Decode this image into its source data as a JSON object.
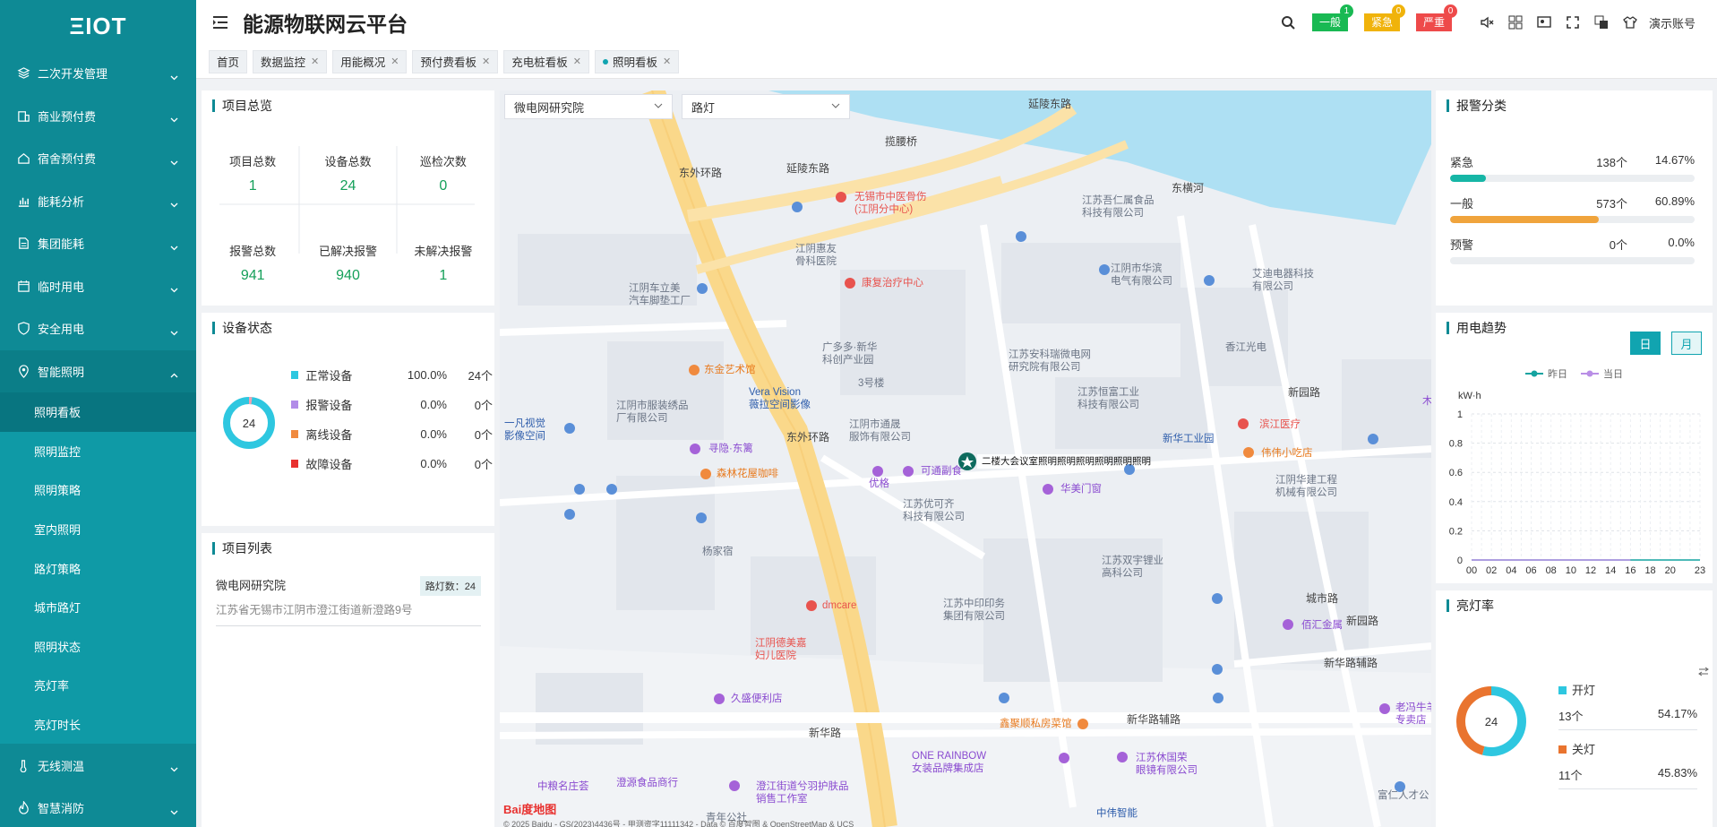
{
  "app": {
    "logo": "ΞIOT",
    "title": "能源物联网云平台",
    "user": "演示账号"
  },
  "colors": {
    "sidebar": "#0e8a95",
    "accent": "#0e8a95",
    "value_green": "#15a05a",
    "normal": "#11a4b0",
    "alarm_general": "#19b953",
    "alarm_urgent": "#f0b30b",
    "alarm_severe": "#ee4a4a"
  },
  "sidebar": {
    "menus": [
      {
        "label": "二次开发管理",
        "icon": "layers-icon"
      },
      {
        "label": "商业预付费",
        "icon": "building-icon"
      },
      {
        "label": "宿舍预付费",
        "icon": "home-icon"
      },
      {
        "label": "能耗分析",
        "icon": "bar-chart-icon"
      },
      {
        "label": "集团能耗",
        "icon": "document-icon"
      },
      {
        "label": "临时用电",
        "icon": "calendar-icon"
      },
      {
        "label": "安全用电",
        "icon": "shield-icon"
      },
      {
        "label": "智能照明",
        "icon": "location-icon"
      }
    ],
    "submenu": [
      "照明看板",
      "照明监控",
      "照明策略",
      "室内照明",
      "路灯策略",
      "城市路灯",
      "照明状态",
      "亮灯率",
      "亮灯时长"
    ],
    "bottom": [
      {
        "label": "无线测温",
        "icon": "thermometer-icon"
      },
      {
        "label": "智慧消防",
        "icon": "fire-icon"
      }
    ]
  },
  "header": {
    "alarms": [
      {
        "label": "一般",
        "count": "1"
      },
      {
        "label": "紧急",
        "count": "0"
      },
      {
        "label": "严重",
        "count": "0"
      }
    ]
  },
  "tabs": [
    {
      "label": "首页",
      "closable": false
    },
    {
      "label": "数据监控",
      "closable": true
    },
    {
      "label": "用能概况",
      "closable": true
    },
    {
      "label": "预付费看板",
      "closable": true
    },
    {
      "label": "充电桩看板",
      "closable": true
    },
    {
      "label": "照明看板",
      "closable": true,
      "active": true
    }
  ],
  "overview": {
    "title": "项目总览",
    "cells": [
      {
        "label": "项目总数",
        "value": "1"
      },
      {
        "label": "设备总数",
        "value": "24"
      },
      {
        "label": "巡检次数",
        "value": "0"
      },
      {
        "label": "报警总数",
        "value": "941"
      },
      {
        "label": "已解决报警",
        "value": "940"
      },
      {
        "label": "未解决报警",
        "value": "1"
      }
    ]
  },
  "device_status": {
    "title": "设备状态",
    "total": "24",
    "rows": [
      {
        "name": "正常设备",
        "pct": "100.0%",
        "count": "24个",
        "color": "#2ec7e0"
      },
      {
        "name": "报警设备",
        "pct": "0.0%",
        "count": "0个",
        "color": "#b28ce8"
      },
      {
        "name": "离线设备",
        "pct": "0.0%",
        "count": "0个",
        "color": "#f08a3e"
      },
      {
        "name": "故障设备",
        "pct": "0.0%",
        "count": "0个",
        "color": "#e8312f"
      }
    ]
  },
  "project_list": {
    "title": "项目列表",
    "items": [
      {
        "name": "微电网研究院",
        "badge": "路灯数：24",
        "address": "江苏省无锡市江阴市澄江街道新澄路9号"
      }
    ]
  },
  "map": {
    "select1": "微电网研究院",
    "select2": "路灯",
    "marker_label": "二楼大会议室照明照明照明照明照明照明",
    "pois": {
      "road_yanling_e": "延陵东路",
      "road_yanling": "延陵东路",
      "bridge": "揽腰桥",
      "river": "东横河",
      "road_dongwai": "东外环路",
      "road_dongwai2": "东外环路",
      "road_xinhua": "新华路",
      "road_xinhuafu": "新华路辅路",
      "road_xinhuafu2": "新华路辅路",
      "road_chengshi": "城市路",
      "road_xinyuan": "新园路",
      "road_xinyuan2": "新园路",
      "yangjiasu": "杨家宿",
      "p1": "无锡市中医骨伤\n(江阴分中心)",
      "p2": "江阴惠友\n骨科医院",
      "p3": "康复治疗中心",
      "p4": "江苏吾仁属食品\n科技有限公司",
      "p5": "江阴市华滨\n电气有限公司",
      "p6": "艾迪电器科技\n有限公司",
      "p7": "江阴车立美\n汽车脚垫工厂",
      "p8": "广多多·新华\n科创产业园",
      "p9": "江苏安科瑞微电网\n研究院有限公司",
      "p10": "香江光电",
      "p11": "东金艺术馆",
      "p12": "Vera Vision\n薇拉空间影像",
      "p13": "3号楼",
      "p14": "江苏恒富工业\n科技有限公司",
      "p15": "木墨型材",
      "p16": "江阴市服装绣品\n厂有限公司",
      "p17": "江阴市通晟\n服饰有限公司",
      "p18": "滨江医疗",
      "p19": "新华工业园",
      "p20": "伟伟小吃店",
      "p21": "一凡视觉\n影像空间",
      "p22": "寻隐·东篱",
      "p23": "森林花屋咖啡",
      "p24": "优格",
      "p25": "可通副食",
      "p26": "华美门窗",
      "p27": "江阴华建工程\n机械有限公司",
      "p28": "江苏优可齐\n科技有限公司",
      "p29": "江苏双宇锂业\n高科公司",
      "p30": "dmcare",
      "p31": "江阴德美嘉\n妇儿医院",
      "p32": "江苏中印印务\n集团有限公司",
      "p33": "佰汇金属",
      "p34": "久盛便利店",
      "p35": "鑫聚顺私房菜馆",
      "p36": "老冯牛羊肉\n专卖店",
      "p37": "ONE RAINBOW\n女装品牌集成店",
      "p38": "江苏休国荣\n眼镜有限公司",
      "p39": "中粮名庄荟",
      "p40": "澄源食品商行",
      "p41": "澄江街道兮羽护肤品\n销售工作室",
      "p42": "富仁人才公",
      "p43": "中伟智能",
      "p44": "青年公社",
      "logo": "Bai度地图",
      "copyright": "© 2025 Baidu - GS(2023)4436号 - 甲测资字11111342 - Data © 百度智图 & OpenStreetMap & UCS"
    }
  },
  "alarm_class": {
    "title": "报警分类",
    "rows": [
      {
        "name": "紧急",
        "count": "138个",
        "pct": "14.67%",
        "ratio": 0.1467,
        "color": "#16b6a6"
      },
      {
        "name": "一般",
        "count": "573个",
        "pct": "60.89%",
        "ratio": 0.6089,
        "color": "#f0a43c"
      },
      {
        "name": "预警",
        "count": "0个",
        "pct": "0.0%",
        "ratio": 0,
        "color": "#e0e0e0"
      }
    ]
  },
  "trend": {
    "title": "用电趋势",
    "btn_day": "日",
    "btn_month": "月",
    "legend": [
      {
        "name": "昨日",
        "color": "#14a3a0"
      },
      {
        "name": "当日",
        "color": "#b98ee6"
      }
    ],
    "unit": "kW·h"
  },
  "chart_data": {
    "type": "line",
    "x": [
      "00",
      "02",
      "04",
      "06",
      "08",
      "10",
      "12",
      "14",
      "16",
      "18",
      "20",
      "23"
    ],
    "ylim": [
      0,
      1
    ],
    "yticks": [
      "0",
      "0.2",
      "0.4",
      "0.6",
      "0.8",
      "1"
    ],
    "ylabel": "kW·h",
    "series": [
      {
        "name": "昨日",
        "values": [
          0,
          0,
          0,
          0,
          0,
          0,
          0,
          0,
          0,
          0,
          0,
          0
        ]
      },
      {
        "name": "当日",
        "values": [
          0,
          0,
          0,
          0,
          0,
          0,
          0,
          0,
          0
        ]
      }
    ]
  },
  "light_rate": {
    "title": "亮灯率",
    "total": "24",
    "rows": [
      {
        "name": "开灯",
        "count": "13个",
        "pct": "54.17%",
        "ratio": 0.5417,
        "color": "#2ec7e0"
      },
      {
        "name": "关灯",
        "count": "11个",
        "pct": "45.83%",
        "ratio": 0.4583,
        "color": "#e9742f"
      }
    ]
  }
}
